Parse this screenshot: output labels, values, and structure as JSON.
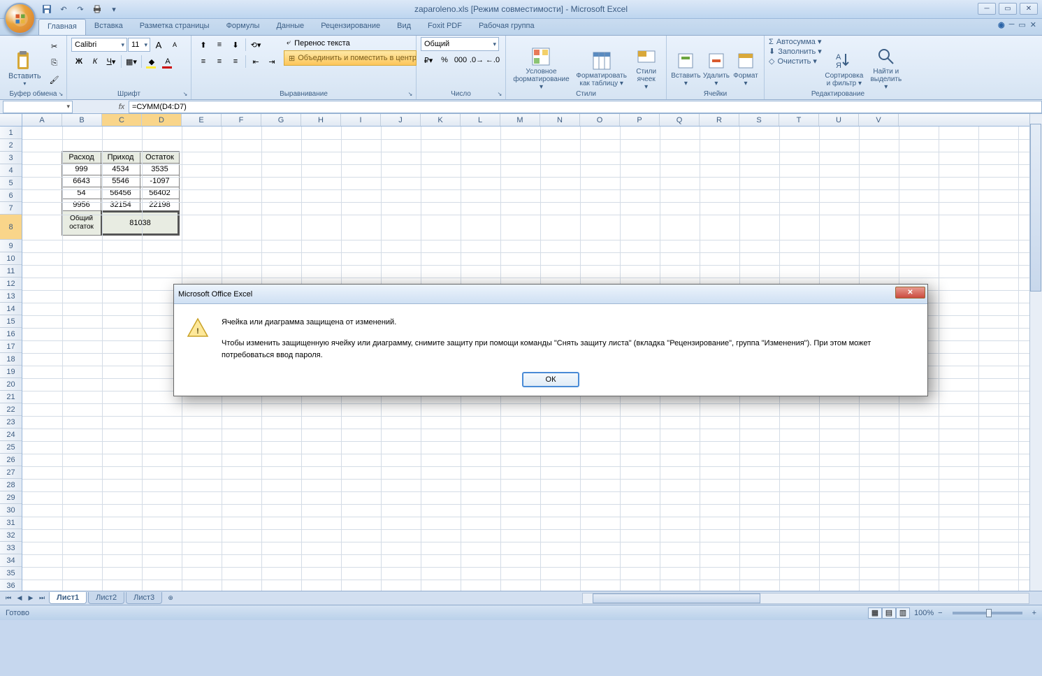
{
  "title": "zaparoleno.xls  [Режим совместимости] - Microsoft Excel",
  "tabs": [
    "Главная",
    "Вставка",
    "Разметка страницы",
    "Формулы",
    "Данные",
    "Рецензирование",
    "Вид",
    "Foxit PDF",
    "Рабочая группа"
  ],
  "groups": {
    "clipboard": "Буфер обмена",
    "font": "Шрифт",
    "alignment": "Выравнивание",
    "number": "Число",
    "styles": "Стили",
    "cells": "Ячейки",
    "editing": "Редактирование"
  },
  "btn": {
    "paste": "Вставить",
    "wrap": "Перенос текста",
    "merge": "Объединить и поместить в центре",
    "condFmt": "Условное форматирование ▾",
    "fmtTable": "Форматировать как таблицу ▾",
    "cellStyles": "Стили ячеек ▾",
    "insert": "Вставить ▾",
    "delete": "Удалить ▾",
    "format": "Формат ▾",
    "autosum": "Автосумма ▾",
    "fill": "Заполнить ▾",
    "clear": "Очистить ▾",
    "sort": "Сортировка и фильтр ▾",
    "find": "Найти и выделить ▾"
  },
  "font": {
    "name": "Calibri",
    "size": "11"
  },
  "numberFormat": "Общий",
  "nameBox": "",
  "formula": "=СУММ(D4:D7)",
  "columns": [
    "A",
    "B",
    "C",
    "D",
    "E",
    "F",
    "G",
    "H",
    "I",
    "J",
    "K",
    "L",
    "M",
    "N",
    "O",
    "P",
    "Q",
    "R",
    "S",
    "T",
    "U",
    "V"
  ],
  "table": {
    "headers": [
      "Расход",
      "Приход",
      "Остаток"
    ],
    "rows": [
      [
        "999",
        "4534",
        "3535"
      ],
      [
        "6643",
        "5546",
        "-1097"
      ],
      [
        "54",
        "56456",
        "56402"
      ],
      [
        "9956",
        "32154",
        "22198"
      ]
    ],
    "sumLabel": "Общий остаток",
    "sumValue": "81038"
  },
  "dialog": {
    "title": "Microsoft Office Excel",
    "line1": "Ячейка или диаграмма защищена от изменений.",
    "line2": "Чтобы изменить защищенную ячейку или диаграмму, снимите защиту при помощи команды \"Снять защиту листа\" (вкладка \"Рецензирование\", группа \"Изменения\"). При этом может потребоваться ввод пароля.",
    "ok": "ОК"
  },
  "sheets": [
    "Лист1",
    "Лист2",
    "Лист3"
  ],
  "status": "Готово",
  "zoom": "100%"
}
